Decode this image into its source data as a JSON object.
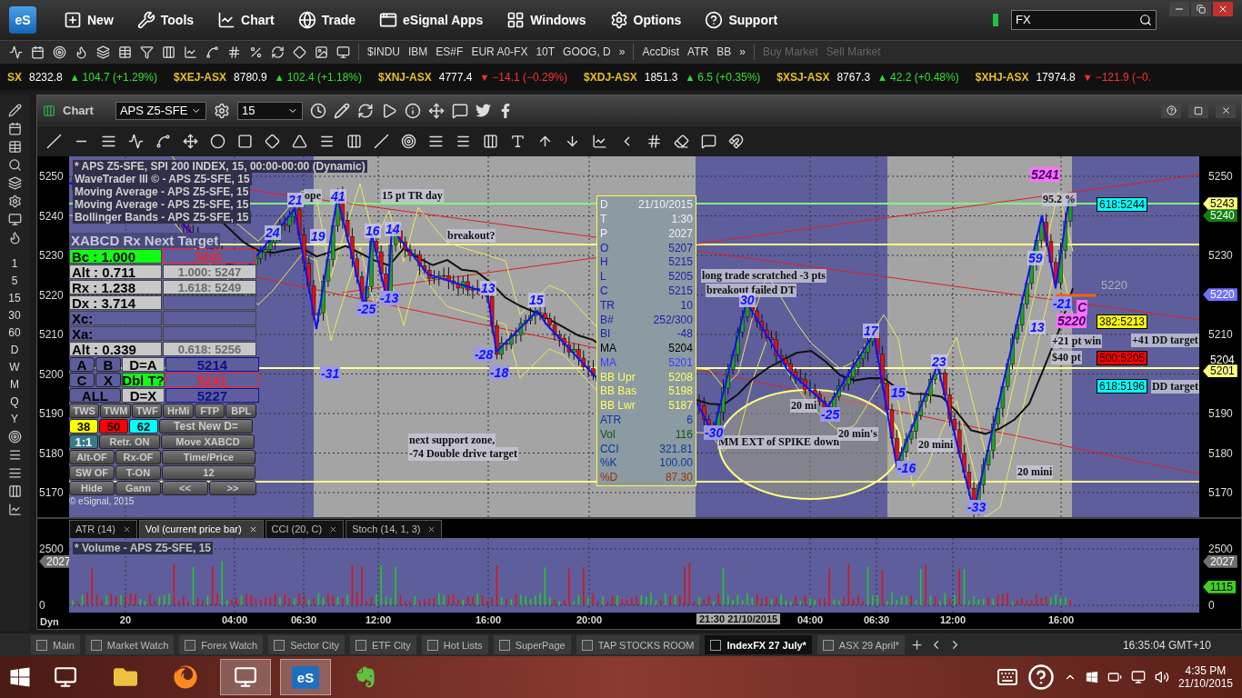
{
  "app": {
    "logo": "eS"
  },
  "menu": [
    {
      "label": "New"
    },
    {
      "label": "Tools"
    },
    {
      "label": "Chart"
    },
    {
      "label": "Trade"
    },
    {
      "label": "eSignal Apps"
    },
    {
      "label": "Windows"
    },
    {
      "label": "Options"
    },
    {
      "label": "Support"
    }
  ],
  "search": {
    "value": "FX"
  },
  "toolbar": {
    "symbols": [
      "$INDU",
      "IBM",
      "ES#F",
      "EUR A0-FX",
      "10T",
      "GOOG, D"
    ],
    "more": "»",
    "studies": [
      "AccDist",
      "ATR",
      "BB"
    ],
    "more_studies": "»",
    "orders": [
      {
        "label": "Buy Market",
        "disabled": true
      },
      {
        "label": "Sell Market",
        "disabled": true
      }
    ]
  },
  "ticker": [
    {
      "symbol": "SX",
      "price": "8232.8",
      "arrow": "▲",
      "change": "104.7 (+1.29%)",
      "rising": true
    },
    {
      "symbol": "$XEJ-ASX",
      "price": "8780.9",
      "arrow": "▲",
      "change": "102.4 (+1.18%)",
      "rising": true
    },
    {
      "symbol": "$XNJ-ASX",
      "price": "4777.4",
      "arrow": "▼",
      "change": "−14.1 (−0.29%)",
      "rising": false
    },
    {
      "symbol": "$XDJ-ASX",
      "price": "1851.3",
      "arrow": "▲",
      "change": "6.5 (+0.35%)",
      "rising": true
    },
    {
      "symbol": "$XSJ-ASX",
      "price": "8767.3",
      "arrow": "▲",
      "change": "42.2 (+0.48%)",
      "rising": true
    },
    {
      "symbol": "$XHJ-ASX",
      "price": "17974.8",
      "arrow": "▼",
      "change": "−121.9 (−0.",
      "rising": false
    }
  ],
  "intervals": [
    "1",
    "5",
    "15",
    "30",
    "60",
    "D",
    "W",
    "M",
    "Q",
    "Y"
  ],
  "chart": {
    "title": "Chart",
    "symbol": "APS Z5-SFE",
    "interval": "15",
    "legend": [
      {
        "text": "* APS Z5-SFE, SPI 200 INDEX, 15, 00:00-00:00 (Dynamic)"
      },
      {
        "text": "WaveTrader III © - APS Z5-SFE, 15"
      },
      {
        "text": "Moving Average - APS Z5-SFE, 15"
      },
      {
        "text": "Moving Average - APS Z5-SFE, 15"
      },
      {
        "text": "Bollinger Bands - APS Z5-SFE, 15"
      }
    ],
    "price_ticks": [
      "5250",
      "5230",
      "5210",
      "5190",
      "5180",
      "5170"
    ],
    "left_price_ticks": [
      "5250",
      "5240",
      "5230",
      "5220",
      "5210",
      "5200",
      "5190",
      "5180",
      "5170"
    ],
    "price_tags": [
      {
        "label": "5243",
        "color": "#ffff80"
      },
      {
        "label": "5240",
        "color": "#108010"
      },
      {
        "label": "5220",
        "color": "#7070ff"
      },
      {
        "label": "5204",
        "color": "#000000"
      },
      {
        "label": "5201",
        "color": "#ffff80"
      }
    ],
    "fib_labels": [
      {
        "label": "618:5244",
        "color": "#00ffff"
      },
      {
        "label": "382:5213",
        "color": "#ffff00"
      },
      {
        "label": "500:5205",
        "color": "#ff0000"
      },
      {
        "label": "618:5196",
        "color": "#00ffff"
      }
    ],
    "line_label": "5220",
    "annotations": [
      {
        "text": "ope",
        "kind": "note"
      },
      {
        "text": "15 pt TR day",
        "kind": "note"
      },
      {
        "text": "breakout?",
        "kind": "note"
      },
      {
        "text": "long trade scratched -3 pts",
        "kind": "note"
      },
      {
        "text": "breakout failed DT",
        "kind": "note"
      },
      {
        "text": "next support zone,",
        "kind": "note"
      },
      {
        "text": "-74 Double drive target",
        "kind": "note"
      },
      {
        "text": "MM EXT of SPIKE down",
        "kind": "note"
      },
      {
        "text": "20 mi",
        "kind": "note"
      },
      {
        "text": "20 min's",
        "kind": "note"
      },
      {
        "text": "20 mini",
        "kind": "note"
      },
      {
        "text": "20 mini",
        "kind": "note"
      },
      {
        "text": "+21 pt win",
        "kind": "note"
      },
      {
        "text": "$40 pt",
        "kind": "note"
      },
      {
        "text": "+41 DD target",
        "kind": "note"
      },
      {
        "text": "DD target",
        "kind": "note"
      },
      {
        "text": "95.2 %",
        "kind": "note"
      },
      {
        "text": "24",
        "kind": "peak"
      },
      {
        "text": "21",
        "kind": "peak"
      },
      {
        "text": "41",
        "kind": "peak"
      },
      {
        "text": "19",
        "kind": "peak"
      },
      {
        "text": "16",
        "kind": "peak"
      },
      {
        "text": "14",
        "kind": "peak"
      },
      {
        "text": "-25",
        "kind": "trough"
      },
      {
        "text": "-13",
        "kind": "trough"
      },
      {
        "text": "-31",
        "kind": "trough"
      },
      {
        "text": "13",
        "kind": "peak"
      },
      {
        "text": "-28",
        "kind": "trough"
      },
      {
        "text": "15",
        "kind": "peak"
      },
      {
        "text": "-18",
        "kind": "trough"
      },
      {
        "text": "30",
        "kind": "peak"
      },
      {
        "text": "-30",
        "kind": "trough"
      },
      {
        "text": "17",
        "kind": "peak"
      },
      {
        "text": "-25",
        "kind": "trough"
      },
      {
        "text": "15",
        "kind": "trough"
      },
      {
        "text": "23",
        "kind": "peak"
      },
      {
        "text": "-16",
        "kind": "trough"
      },
      {
        "text": "-33",
        "kind": "trough"
      },
      {
        "text": "59",
        "kind": "peak"
      },
      {
        "text": "13",
        "kind": "peak"
      },
      {
        "text": "-21",
        "kind": "trough"
      },
      {
        "text": "5241",
        "kind": "point"
      },
      {
        "text": "C",
        "kind": "point"
      },
      {
        "text": "5220",
        "kind": "point"
      }
    ],
    "data_window": [
      {
        "label": "D",
        "value": "21/10/2015",
        "color": "#f0f0f0"
      },
      {
        "label": "T",
        "value": "1:30",
        "color": "#f0f0f0"
      },
      {
        "label": "P",
        "value": "2027",
        "color": "#f0f0f0"
      },
      {
        "label": "O",
        "value": "5207",
        "color": "#2020b0"
      },
      {
        "label": "H",
        "value": "5215",
        "color": "#2020b0"
      },
      {
        "label": "L",
        "value": "5205",
        "color": "#2020b0"
      },
      {
        "label": "C",
        "value": "5215",
        "color": "#2020b0"
      },
      {
        "label": "TR",
        "value": "10",
        "color": "#2020b0"
      },
      {
        "label": "B#",
        "value": "252/300",
        "color": "#2020b0"
      },
      {
        "label": "BI",
        "value": "-48",
        "color": "#2020b0"
      },
      {
        "label": "MA",
        "value": "5204",
        "color": "#000000"
      },
      {
        "label": "MA",
        "value": "5201",
        "color": "#3a3aff"
      },
      {
        "label": "BB Upr",
        "value": "5208",
        "color": "#ffff60"
      },
      {
        "label": "BB Bas",
        "value": "5198",
        "color": "#ffff60"
      },
      {
        "label": "BB Lwr",
        "value": "5187",
        "color": "#ffff60"
      },
      {
        "label": "ATR",
        "value": "6",
        "color": "#0a3a9a"
      },
      {
        "label": "Vol",
        "value": "116",
        "color": "#0a5a0a"
      },
      {
        "label": "CCI",
        "value": "321.81",
        "color": "#0a3a9a"
      },
      {
        "label": "%K",
        "value": "100.00",
        "color": "#0a3a9a"
      },
      {
        "label": "%D",
        "value": "87.30",
        "color": "#a03000"
      }
    ],
    "xabcd": {
      "title": "XABCD Rx Next Target",
      "ratios": [
        {
          "label": "Bc :",
          "value": "1.000",
          "active": true,
          "target": "5241",
          "target_alert": true
        },
        {
          "label": "Alt :",
          "value": "0.711",
          "active": false,
          "target": "1.000: 5247",
          "target_alert": false
        },
        {
          "label": "Rx :",
          "value": "1.238",
          "active": false,
          "target": "1.618: 5249",
          "target_alert": false
        },
        {
          "label": "Dx :",
          "value": "3.714",
          "active": false,
          "target_alert": false
        },
        {
          "label": "Xc:",
          "active": false,
          "target_alert": false
        },
        {
          "label": "Xa:",
          "active": false,
          "target_alert": false
        },
        {
          "label": "Alt :",
          "value": "0.339",
          "active": false,
          "target": "0.618: 5256",
          "target_alert": false
        }
      ],
      "legs": [
        {
          "keys": [
            "A",
            "B"
          ],
          "rule": "D=A",
          "rule_active": false,
          "value": "5214",
          "value_alert": false
        },
        {
          "keys": [
            "C",
            "X"
          ],
          "rule": "Dbl T?",
          "rule_active": true,
          "value": "5241",
          "value_alert": true
        },
        {
          "keys": [
            "ALL"
          ],
          "rule": "D=X",
          "rule_active": false,
          "value": "5227",
          "value_alert": false
        }
      ],
      "wave_buttons": [
        "TWS",
        "TWM",
        "TWF",
        "HrMi",
        "FTP",
        "BPL"
      ],
      "fib_buttons": [
        {
          "label": "38",
          "color": "#ffff00"
        },
        {
          "label": "50",
          "color": "#ff0000"
        },
        {
          "label": "62",
          "color": "#00ffff"
        }
      ],
      "test_button": "Test New D=",
      "ratio_button": "1:1",
      "controls": [
        [
          "Retr. ON",
          "Move XABCD"
        ],
        [
          "Alt-OF",
          "Rx-OF",
          "Time/Price"
        ],
        [
          "SW OF",
          "T-ON",
          "12"
        ],
        [
          "Hide",
          "Gann",
          "<<",
          ">>"
        ]
      ]
    },
    "copyright": "© eSignal, 2015",
    "pane_tabs": [
      {
        "label": "ATR (14)",
        "selected": false
      },
      {
        "label": "Vol (current price bar)",
        "selected": true
      },
      {
        "label": "CCI (20, C)",
        "selected": false
      },
      {
        "label": "Stoch (14, 1, 3)",
        "selected": false
      }
    ],
    "volume": {
      "legend": "* Volume - APS Z5-SFE, 15",
      "ticks": [
        "2500",
        "0"
      ],
      "left_ticks": [
        "2500",
        "0"
      ],
      "left_tag": "2027",
      "tags": [
        {
          "label": "2027",
          "color": "#707070"
        },
        {
          "label": "1115",
          "color": "#40d020"
        }
      ]
    },
    "x_axis": {
      "mode": "Dyn",
      "labels": [
        "20",
        "04:00",
        "06:30",
        "12:00",
        "16:00",
        "20:00",
        "04:00",
        "06:30",
        "12:00",
        "16:00"
      ],
      "cursor_label": "21:30 21/10/2015"
    }
  },
  "page_tabs": [
    {
      "label": "Main",
      "selected": false
    },
    {
      "label": "Market Watch",
      "selected": false
    },
    {
      "label": "Forex Watch",
      "selected": false
    },
    {
      "label": "Sector City",
      "selected": false
    },
    {
      "label": "ETF City",
      "selected": false
    },
    {
      "label": "Hot Lists",
      "selected": false
    },
    {
      "label": "SuperPage",
      "selected": false
    },
    {
      "label": "TAP STOCKS ROOM",
      "selected": false
    },
    {
      "label": "IndexFX 27 July*",
      "selected": true
    },
    {
      "label": "ASX 29 April*",
      "selected": false
    }
  ],
  "clock": {
    "time": "16:35:04",
    "zone": "GMT+10"
  },
  "taskbar": {
    "app_label": "eS",
    "time": "4:35 PM",
    "date": "21/10/2015"
  }
}
